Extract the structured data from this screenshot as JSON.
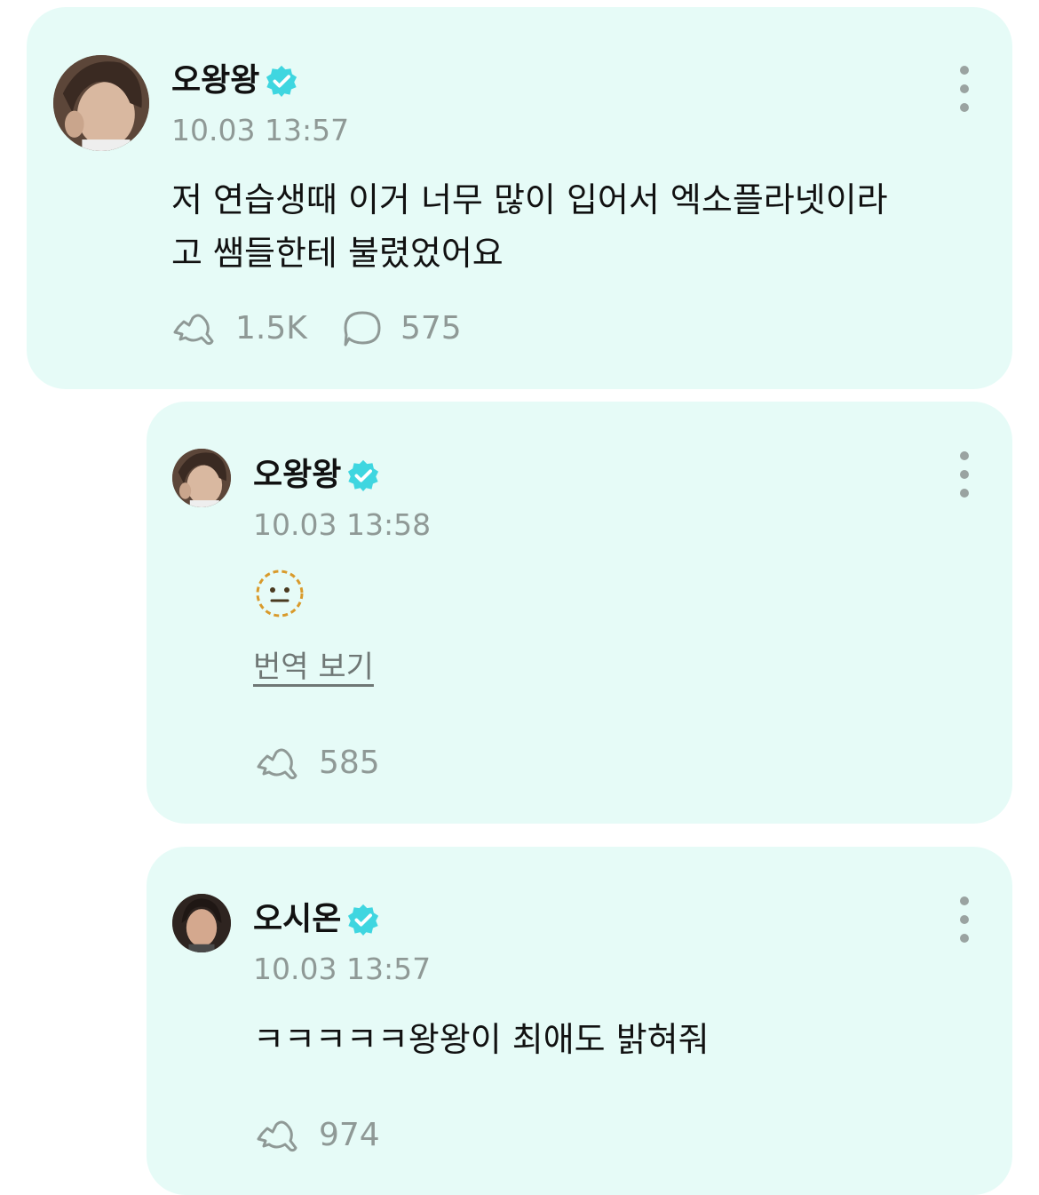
{
  "accent_color": "#3fd6e0",
  "card_background": "#e6fbf7",
  "posts": [
    {
      "author": "오왕왕",
      "verified": true,
      "timestamp": "10.03 13:57",
      "text_line1": "저 연습생때 이거 너무 많이 입어서 엑소플라넷이라",
      "text_line2": "고 쌤들한테 불렸었어요",
      "likes": "1.5K",
      "comments": "575",
      "icons": [
        "avatar",
        "verified-badge-icon",
        "more-options-icon",
        "like-icon",
        "comment-icon"
      ]
    },
    {
      "author": "오왕왕",
      "verified": true,
      "timestamp": "10.03 13:58",
      "emoji": "neutral-face-dotted",
      "translate_label": "번역 보기",
      "likes": "585"
    },
    {
      "author": "오시온",
      "verified": true,
      "timestamp": "10.03 13:57",
      "text_line1": "ㅋㅋㅋㅋㅋ왕왕이 최애도 밝혀줘",
      "likes": "974"
    }
  ]
}
